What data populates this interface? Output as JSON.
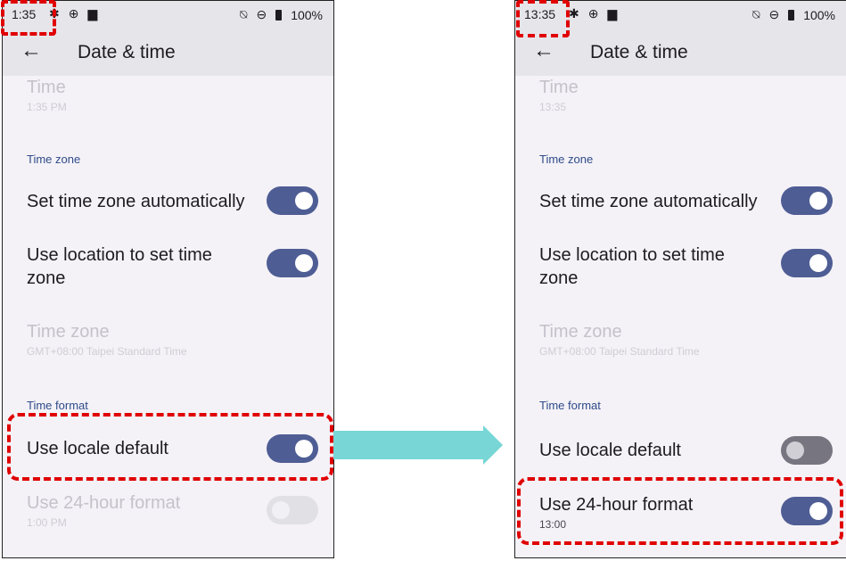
{
  "left_screen": {
    "status_time": "1:35",
    "battery": "100%",
    "title": "Date & time",
    "time": {
      "title": "Time",
      "summary": "1:35 PM"
    },
    "timezone_header": "Time zone",
    "auto_timezone": {
      "title": "Set time zone automatically",
      "state": "on"
    },
    "location_timezone": {
      "title_line1": "Use location to set time",
      "title_line2": "zone",
      "state": "on"
    },
    "timezone": {
      "title": "Time zone",
      "summary": "GMT+08:00 Taipei Standard Time"
    },
    "timeformat_header": "Time format",
    "locale_default": {
      "title": "Use locale default",
      "state": "on"
    },
    "format_24h": {
      "title": "Use 24-hour format",
      "summary": "1:00 PM",
      "state": "disabled"
    }
  },
  "right_screen": {
    "status_time": "13:35",
    "battery": "100%",
    "title": "Date & time",
    "time": {
      "title": "Time",
      "summary": "13:35"
    },
    "timezone_header": "Time zone",
    "auto_timezone": {
      "title": "Set time zone automatically",
      "state": "on"
    },
    "location_timezone": {
      "title_line1": "Use location to set time",
      "title_line2": "zone",
      "state": "on"
    },
    "timezone": {
      "title": "Time zone",
      "summary": "GMT+08:00 Taipei Standard Time"
    },
    "timeformat_header": "Time format",
    "locale_default": {
      "title": "Use locale default",
      "state": "off"
    },
    "format_24h": {
      "title": "Use 24-hour format",
      "summary": "13:00",
      "state": "on"
    }
  },
  "colors": {
    "accent": "#4e5d94",
    "highlight": "#e00000",
    "arrow": "#78d6d6"
  },
  "icons": [
    "back-arrow-icon",
    "notification-off-icon",
    "do-not-disturb-icon",
    "battery-icon"
  ]
}
